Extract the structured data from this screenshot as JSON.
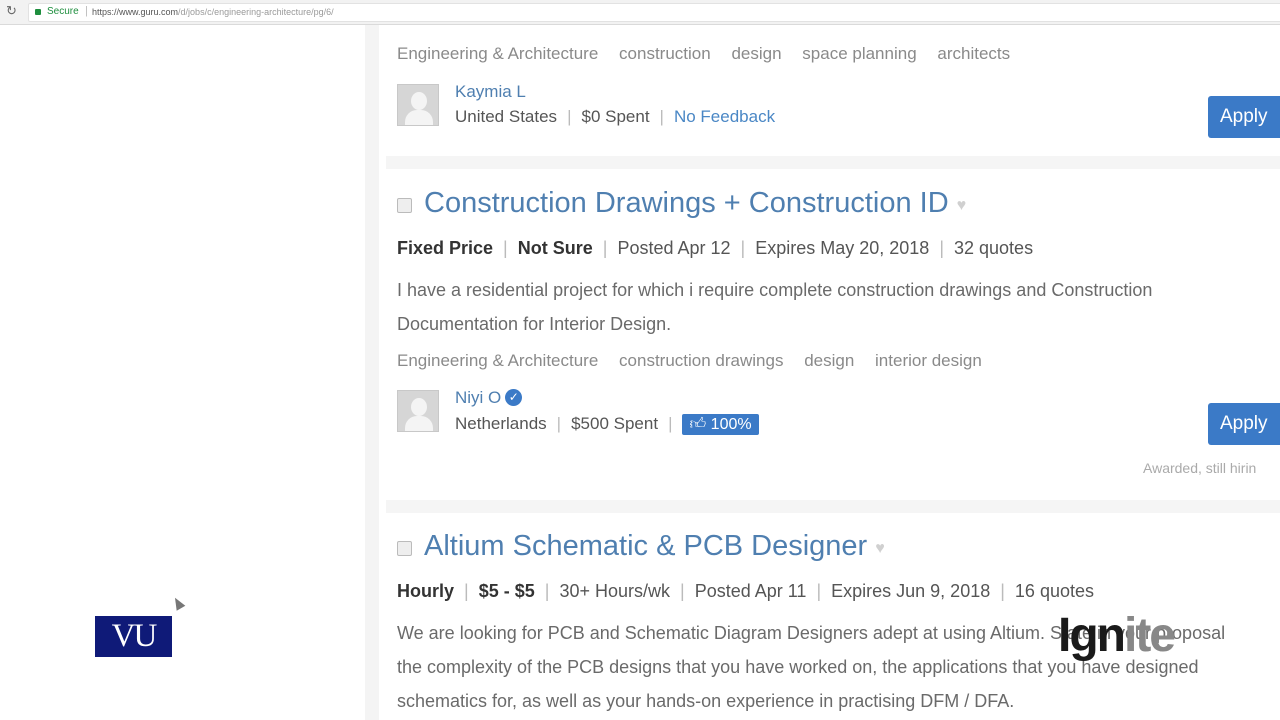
{
  "browser": {
    "secure_label": "Secure",
    "url_host": "https://www.guru.com",
    "url_path": "/d/jobs/c/engineering-architecture/pg/6/"
  },
  "jobs": [
    {
      "tags": [
        "Engineering & Architecture",
        "construction",
        "design",
        "space planning",
        "architects"
      ],
      "client": {
        "name": "Kaymia L",
        "country": "United States",
        "spent": "$0 Spent",
        "feedback": "No Feedback"
      },
      "apply_label": "Apply"
    },
    {
      "title": "Construction Drawings + Construction ID",
      "budget_type": "Fixed Price",
      "budget": "Not Sure",
      "posted": "Posted Apr 12",
      "expires": "Expires May 20, 2018",
      "quotes": "32 quotes",
      "description": "I have a residential project for which i require complete construction drawings and Construction Documentation for Interior Design.",
      "tags": [
        "Engineering & Architecture",
        "construction drawings",
        "design",
        "interior design"
      ],
      "client": {
        "name": "Niyi O",
        "country": "Netherlands",
        "spent": "$500 Spent",
        "rating": "100%"
      },
      "apply_label": "Apply",
      "status": "Awarded, still hirin"
    },
    {
      "title": "Altium Schematic & PCB Designer",
      "budget_type": "Hourly",
      "budget": "$5 - $5",
      "hours": "30+ Hours/wk",
      "posted": "Posted Apr 11",
      "expires": "Expires Jun 9, 2018",
      "quotes": "16 quotes",
      "description": "We are looking for PCB and Schematic Diagram Designers adept at using Altium. State in your proposal the complexity of the PCB designs that you have worked on, the applications that you have designed schematics for, as well as your hands-on experience in practising DFM / DFA."
    }
  ],
  "overlay": {
    "vu_logo": "VU",
    "ignite_a": "Ign",
    "ignite_b": "ite"
  }
}
